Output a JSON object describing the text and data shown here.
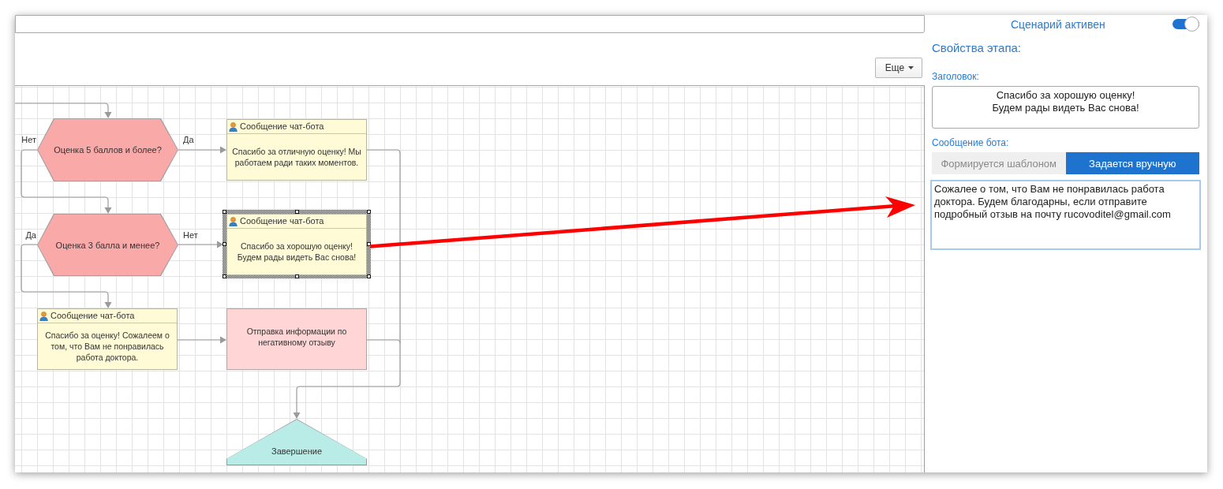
{
  "toolbar": {
    "more_button": "Еще"
  },
  "diagram": {
    "nodes": [
      {
        "kind": "decision",
        "text": "Оценка 5 баллов и более?",
        "left_label": "Нет",
        "right_label": "Да",
        "selected": false
      },
      {
        "kind": "message",
        "header": "Сообщение чат-бота",
        "text": "Спасибо за отличную оценку! Мы работаем ради таких моментов.",
        "selected": false
      },
      {
        "kind": "decision",
        "text": "Оценка 3 балла и менее?",
        "left_label": "Да",
        "right_label": "Нет",
        "selected": false
      },
      {
        "kind": "message",
        "header": "Сообщение чат-бота",
        "text": "Спасибо за хорошую оценку!\nБудем рады видеть Вас снова!",
        "selected": true
      },
      {
        "kind": "message",
        "header": "Сообщение чат-бота",
        "text": "Спасибо за оценку! Сожалеем о том, что Вам не понравилась работа доктора.",
        "selected": false
      },
      {
        "kind": "action",
        "text": "Отправка информации по негативному отзыву",
        "selected": false
      },
      {
        "kind": "end",
        "text": "Завершение",
        "selected": false
      }
    ]
  },
  "panel": {
    "scenario_label": "Сценарий активен",
    "scenario_active": true,
    "section_title": "Свойства этапа:",
    "title_label": "Заголовок:",
    "title_value": "Спасибо за хорошую оценку!\nБудем рады видеть Вас снова!",
    "message_label": "Сообщение бота:",
    "message_modes": [
      {
        "label": "Формируется шаблоном",
        "selected": false
      },
      {
        "label": "Задается вручную",
        "selected": true
      }
    ],
    "message_value": "Сожалее о том, что Вам не понравилась работа доктора. Будем благодарны, если отправите подробный отзыв на почту rucovoditel@gmail.com"
  }
}
